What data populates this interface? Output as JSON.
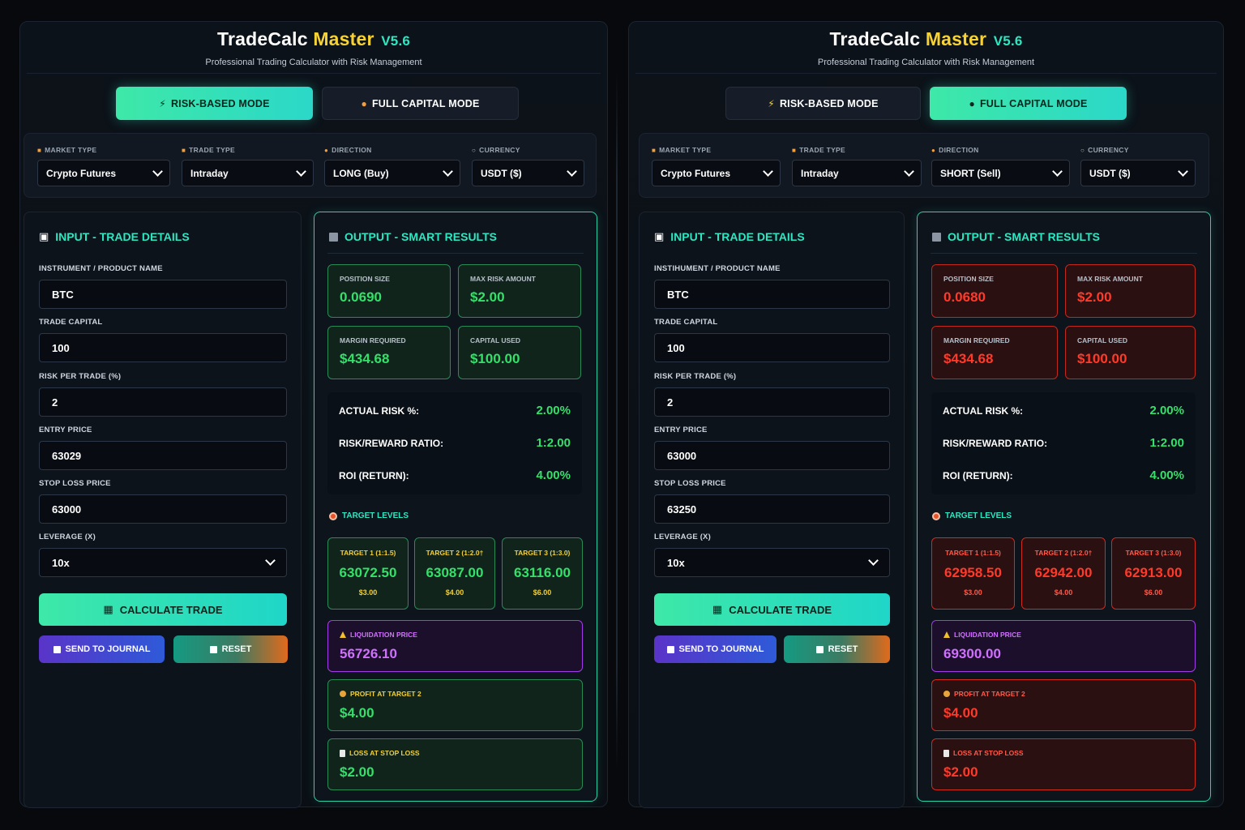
{
  "app": {
    "title_part1": "TradeCalc",
    "title_part2": "Master",
    "version": "V5.6",
    "subtitle": "Professional Trading Calculator with Risk Management"
  },
  "modes": {
    "risk_label": "RISK-BASED MODE",
    "full_label": "FULL CAPITAL MODE"
  },
  "selector_labels": {
    "market": "MARKET TYPE",
    "trade": "TRADE TYPE",
    "direction": "DIRECTION",
    "currency": "CURRENCY"
  },
  "input_labels": {
    "title": "INPUT - TRADE DETAILS",
    "instrument": "INSTRUMENT / PRODUCT NAME",
    "instrument_right": "INSTIHUMENT / PRODUCT NAME",
    "capital": "TRADE CAPITAL",
    "risk": "RISK PER TRADE (%)",
    "entry": "ENTRY PRICE",
    "stop": "STOP LOSS PRICE",
    "leverage": "LEVERAGE (X)"
  },
  "buttons": {
    "calculate": "CALCULATE TRADE",
    "journal": "SEND TO JOURNAL",
    "reset": "RESET"
  },
  "output_labels": {
    "title": "OUTPUT - SMART RESULTS",
    "position_size": "POSITION SIZE",
    "max_risk": "MAX RISK AMOUNT",
    "margin": "MARGIN REQUIRED",
    "capital_used": "CAPITAL USED",
    "actual_risk": "ACTUAL RISK %:",
    "rr": "RISK/REWARD RATIO:",
    "roi": "ROI (RETURN):",
    "target_levels": "TARGET LEVELS",
    "t1": "TARGET 1 (1:1.5)",
    "t2": "TARGET 2 (1:2.0†",
    "t3": "TARGET 3 (1:3.0)",
    "liquidation": "LIQUIDATION PRICE",
    "profit": "PROFIT AT TARGET 2",
    "loss": "LOSS AT STOP LOSS"
  },
  "left": {
    "mode_active": "risk",
    "market": "Crypto Futures",
    "trade": "Intraday",
    "direction": "LONG (Buy)",
    "currency": "USDT ($)",
    "instrument": "BTC",
    "capital": "100",
    "risk": "2",
    "entry": "63029",
    "stop": "63000",
    "leverage": "10x",
    "position_size": "0.0690",
    "max_risk": "$2.00",
    "margin": "$434.68",
    "capital_used": "$100.00",
    "actual_risk": "2.00%",
    "rr": "1:2.00",
    "roi": "4.00%",
    "t1_price": "63072.50",
    "t1_amt": "$3.00",
    "t2_price": "63087.00",
    "t2_amt": "$4.00",
    "t3_price": "63116.00",
    "t3_amt": "$6.00",
    "liquidation": "56726.10",
    "profit": "$4.00",
    "loss": "$2.00"
  },
  "right": {
    "mode_active": "full",
    "market": "Crypto Futures",
    "trade": "Intraday",
    "direction": "SHORT (Sell)",
    "currency": "USDT ($)",
    "instrument": "BTC",
    "capital": "100",
    "risk": "2",
    "entry": "63000",
    "stop": "63250",
    "leverage": "10x",
    "position_size": "0.0680",
    "max_risk": "$2.00",
    "margin": "$434.68",
    "capital_used": "$100.00",
    "actual_risk": "2.00%",
    "rr": "1:2.00",
    "roi": "4.00%",
    "t1_price": "62958.50",
    "t1_amt": "$3.00",
    "t2_price": "62942.00",
    "t2_amt": "$4.00",
    "t3_price": "62913.00",
    "t3_amt": "$6.00",
    "liquidation": "69300.00",
    "profit": "$4.00",
    "loss": "$2.00"
  },
  "colors": {
    "accent": "#2ee6c2",
    "gold": "#f7d234",
    "profit_green": "#34e06a",
    "loss_red": "#ff3a2a",
    "liquidation_purple": "#d070ff"
  }
}
